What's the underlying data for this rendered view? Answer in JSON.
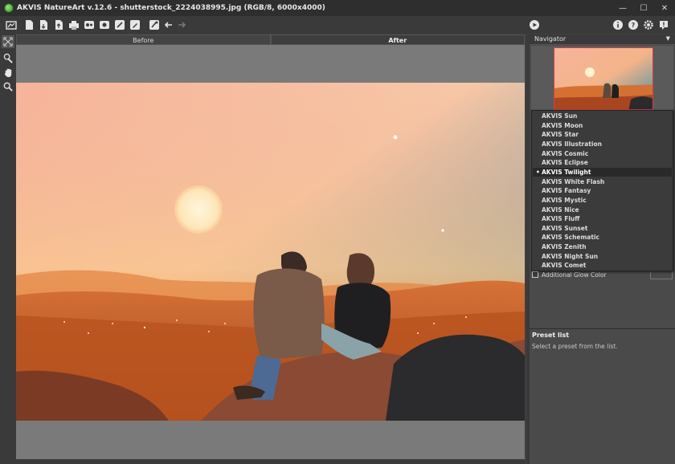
{
  "window": {
    "title": "AKVIS NatureArt v.12.6 - shutterstock_2224038995.jpg (RGB/8, 6000x4000)",
    "controls": {
      "minimize": "—",
      "maximize": "☐",
      "close": "✕"
    }
  },
  "toolbar": {
    "left_icons": [
      "home-icon",
      "new-document-icon",
      "open-icon",
      "save-icon",
      "print-icon",
      "batch-icon",
      "export-icon",
      "settings-brush-icon",
      "pencil-icon",
      "eyedropper-icon",
      "undo-icon",
      "redo-icon"
    ],
    "right_icons": [
      "run-icon",
      "info-icon",
      "help-icon",
      "preferences-icon",
      "notifications-icon"
    ]
  },
  "tools": [
    "expand-icon",
    "effect-brush-icon",
    "hand-icon",
    "zoom-icon"
  ],
  "tabs": {
    "before": "Before",
    "after": "After"
  },
  "navigator": {
    "title": "Navigator"
  },
  "dropdown": {
    "items": [
      "AKVIS Sun",
      "AKVIS Moon",
      "AKVIS Star",
      "AKVIS Illustration",
      "AKVIS Cosmic",
      "AKVIS Eclipse",
      "AKVIS Twilight",
      "AKVIS White Flash",
      "AKVIS Fantasy",
      "AKVIS Mystic",
      "AKVIS Nice",
      "AKVIS Fluff",
      "AKVIS Sunset",
      "AKVIS Schematic",
      "AKVIS Zenith",
      "AKVIS Night Sun",
      "AKVIS Comet"
    ],
    "selected_index": 6,
    "bullet": "•"
  },
  "settings": {
    "additional_glow_label": "Additional Glow Color",
    "additional_glow_checked": false
  },
  "preset_list": {
    "title": "Preset list",
    "hint": "Select a preset from the list."
  },
  "colors": {
    "accent_green": "#2f8a2b",
    "panel_bg": "#4a4a4a",
    "canvas_bg": "#7a7a7a"
  }
}
